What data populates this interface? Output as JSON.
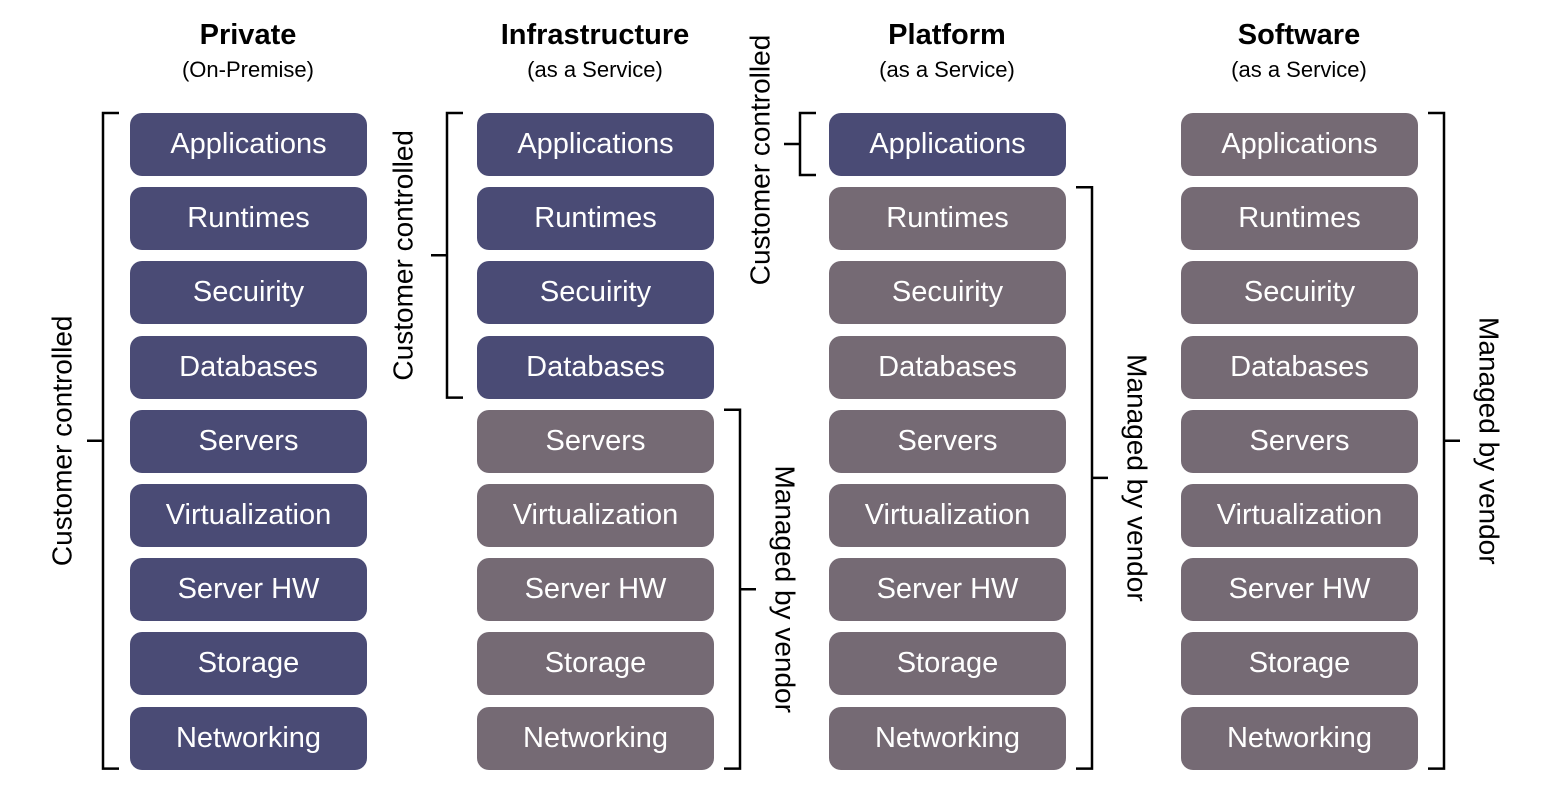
{
  "colors": {
    "customer": "#4a4b75",
    "vendor": "#756a74",
    "text": "#ffffff"
  },
  "layers": [
    "Applications",
    "Runtimes",
    "Secuirity",
    "Databases",
    "Servers",
    "Virtualization",
    "Server HW",
    "Storage",
    "Networking"
  ],
  "columns": [
    {
      "title": "Private",
      "subtitle": "(On-Premise)",
      "customer_controlled_layers": 9
    },
    {
      "title": "Infrastructure",
      "subtitle": "(as a Service)",
      "customer_controlled_layers": 4
    },
    {
      "title": "Platform",
      "subtitle": "(as a Service)",
      "customer_controlled_layers": 1
    },
    {
      "title": "Software",
      "subtitle": "(as a Service)",
      "customer_controlled_layers": 0
    }
  ],
  "labels": {
    "customer": "Customer controlled",
    "vendor": "Managed by vendor"
  }
}
